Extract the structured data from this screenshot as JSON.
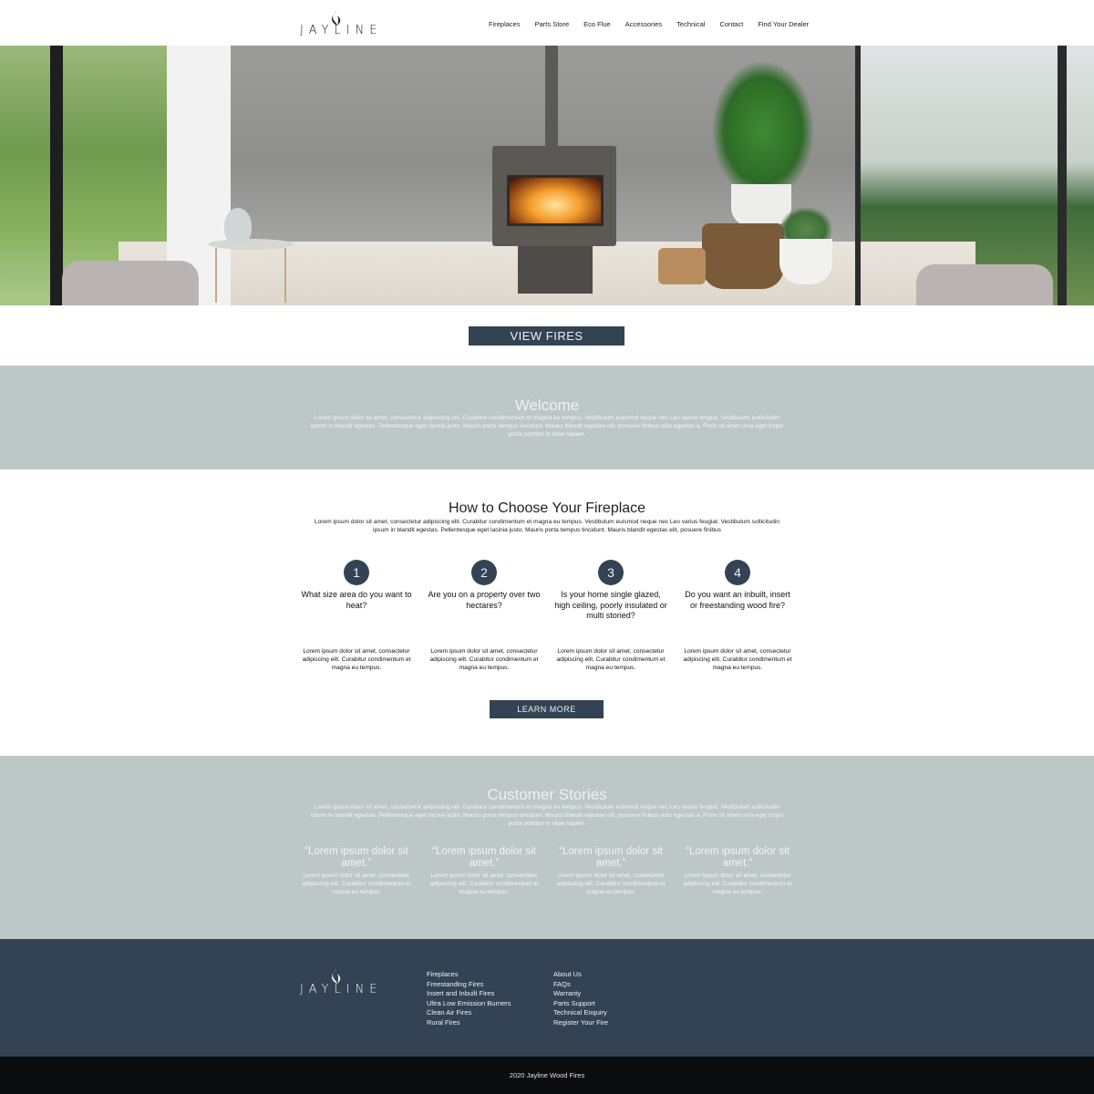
{
  "brand": {
    "name": "JAYLINE"
  },
  "nav": {
    "items": [
      "Fireplaces",
      "Parts Store",
      "Eco Flue",
      "Accessories",
      "Technical",
      "Contact",
      "Find Your Dealer"
    ]
  },
  "hero": {
    "button_label": "VIEW FIRES"
  },
  "welcome": {
    "title": "Welcome",
    "text": "Lorem ipsum dolor sit amet, consectetur adipiscing elit. Curabitur condimentum et magna eu tempus. Vestibulum euismod neque nec Leo varius feugiat. Vestibulum sollicitudin ipsum in blandit egestas. Pellentesque eget lacinia justo. Mauris porta tempus tincidunt. Mauris blandit egestas elit, posuere finibus odio egestas a. Proin sit amet urna eget turpis porta porttitor in vitae sapien."
  },
  "choose": {
    "title": "How to Choose Your Fireplace",
    "text": "Lorem ipsum dolor sit amet, consectetur adipiscing elit. Curabitur condimentum et magna eu tempus. Vestibulum euismod neque nec Leo varius feugiat. Vestibulum sollicitudin ipsum in blandit egestas. Pellentesque eget lacinia justo. Mauris porta tempus tincidunt. Mauris blandit egestas elit, posuere finibus",
    "steps": [
      {
        "num": "1",
        "question": "What size area do you want to heat?",
        "desc": "Lorem ipsum dolor sit amet, consectetur adipiscing elit. Curabitur condimentum et magna eu tempus."
      },
      {
        "num": "2",
        "question": "Are you on a property over two hectares?",
        "desc": "Lorem ipsum dolor sit amet, consectetur adipiscing elit. Curabitur condimentum et magna eu tempus."
      },
      {
        "num": "3",
        "question": "Is your home single glazed, high ceiling, poorly insulated or multi storied?",
        "desc": "Lorem ipsum dolor sit amet, consectetur adipiscing elit. Curabitur condimentum et magna eu tempus."
      },
      {
        "num": "4",
        "question": "Do you want an inbuilt, insert or freestanding wood fire?",
        "desc": "Lorem ipsum dolor sit amet, consectetur adipiscing elit. Curabitur condimentum et magna eu tempus."
      }
    ],
    "button_label": "LEARN MORE"
  },
  "stories": {
    "title": "Customer Stories",
    "text": "Lorem ipsum dolor sit amet, consectetur adipiscing elit. Curabitur condimentum et magna eu tempus. Vestibulum euismod neque nec Leo varius feugiat. Vestibulum sollicitudin ipsum in blandit egestas. Pellentesque eget lacinia justo. Mauris porta tempus tincidunt. Mauris blandit egestas elit, posuere finibus odio egestas a. Proin sit amet urna eget turpis porta porttitor in vitae sapien.",
    "items": [
      {
        "quote": "“Lorem ipsum dolor sit amet.”",
        "text": "Lorem ipsum dolor sit amet, consectetur adipiscing elit. Curabitur condimentum et magna eu tempus."
      },
      {
        "quote": "“Lorem ipsum dolor sit amet.”",
        "text": "Lorem ipsum dolor sit amet, consectetur adipiscing elit. Curabitur condimentum et magna eu tempus."
      },
      {
        "quote": "“Lorem ipsum dolor sit amet.”",
        "text": "Lorem ipsum dolor sit amet, consectetur adipiscing elit. Curabitur condimentum et magna eu tempus."
      },
      {
        "quote": "“Lorem ipsum dolor sit amet.”",
        "text": "Lorem ipsum dolor sit amet, consectetur adipiscing elit. Curabitur condimentum et magna eu tempus."
      }
    ]
  },
  "footer": {
    "col1": [
      "Fireplaces",
      "Freestanding Fires",
      "Insert and Inbuilt Fires",
      "Ultra Low Emission Burners",
      "Clean Air Fires",
      "Rural Fires"
    ],
    "col2": [
      "About Us",
      "FAQs",
      "Warranty",
      "Parts Support",
      "Technical Enquiry",
      "Register Your Fire"
    ],
    "copyright": "2020 Jayline Wood Fires"
  },
  "colors": {
    "accent": "#334354",
    "band": "#bcc7c6",
    "bottom": "#0b0c0d"
  }
}
